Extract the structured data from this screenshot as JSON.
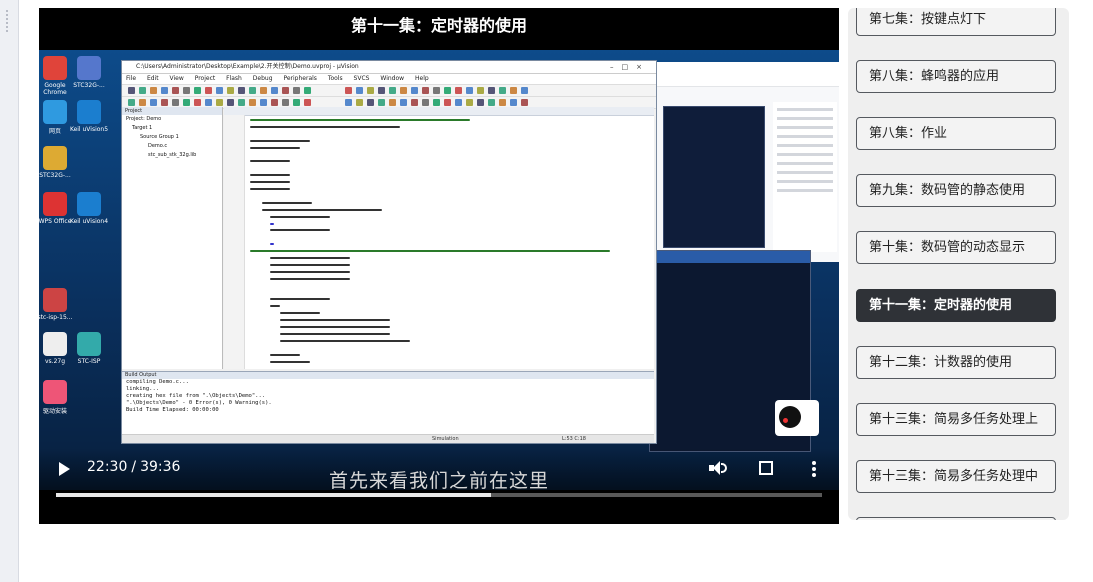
{
  "video": {
    "title": "第十一集：定时器的使用",
    "current_time": "22:30",
    "separator": "/",
    "duration": "39:36",
    "progress": 0.568,
    "subtitle": "首先来看我们之前在这里"
  },
  "ide": {
    "window_title": "C:\\Users\\Administrator\\Desktop\\Example\\2.开关控制\\Demo.uvproj - µVision",
    "menu": [
      "File",
      "Edit",
      "View",
      "Project",
      "Flash",
      "Debug",
      "Peripherals",
      "Tools",
      "SVCS",
      "Window",
      "Help"
    ],
    "project_header": "Project",
    "tree": [
      "Project: Demo",
      "Target 1",
      "Source Group 1",
      "Demo.c",
      "stc_sub_stk_32g.lib"
    ],
    "output_header": "Build Output",
    "output_lines": [
      "compiling Demo.c...",
      "linking...",
      "creating hex file from \".\\Objects\\Demo\"...",
      "\".\\Objects\\Demo\" - 0 Error(s), 0 Warning(s).",
      "Build Time Elapsed:  00:00:00"
    ],
    "status_left": "Simulation",
    "status_right": "L:53 C:18"
  },
  "desktop_icons": [
    "Google Chrome",
    "STC32G-...",
    "网页",
    "Keil uVision5",
    "STC32G-...",
    "WPS Office",
    "Keil uVision4",
    "stc-isp-15...",
    "vs.27g",
    "STC-ISP",
    "驱动安装"
  ],
  "playlist": {
    "items": [
      {
        "label": "第七集：按键点灯下",
        "active": false
      },
      {
        "label": "第八集：蜂鸣器的应用",
        "active": false
      },
      {
        "label": "第八集：作业",
        "active": false
      },
      {
        "label": "第九集：数码管的静态使用",
        "active": false
      },
      {
        "label": "第十集：数码管的动态显示",
        "active": false
      },
      {
        "label": "第十一集：定时器的使用",
        "active": true
      },
      {
        "label": "第十二集：计数器的使用",
        "active": false
      },
      {
        "label": "第十三集：简易多任务处理上",
        "active": false
      },
      {
        "label": "第十三集：简易多任务处理中",
        "active": false
      }
    ]
  },
  "colors": {
    "active_item_bg": "#2f3237",
    "item_border": "#55595f",
    "player_bg": "#000000",
    "desktop_blue": "#0d4b8a"
  },
  "icons": [
    "play-icon",
    "volume-icon",
    "fullscreen-icon",
    "more-vert-icon"
  ]
}
